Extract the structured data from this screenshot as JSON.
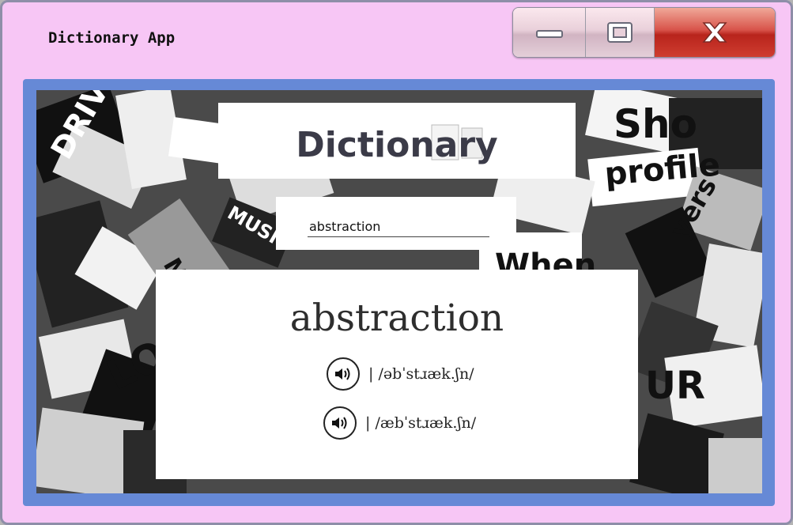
{
  "window": {
    "title": "Dictionary App"
  },
  "app": {
    "logo_text": "Dictionary"
  },
  "search": {
    "value": "abstraction"
  },
  "result": {
    "word": "abstraction",
    "pronunciations": [
      {
        "text": "| /əbˈstɹæk.ʃn/"
      },
      {
        "text": "| /æbˈstɹæk.ʃn/"
      }
    ]
  },
  "colors": {
    "window_bg": "#f7c6f5",
    "frame": "#6689d6",
    "close_button": "#c9362b"
  },
  "icons": [
    "minimize-icon",
    "maximize-icon",
    "close-icon",
    "speaker-icon"
  ]
}
